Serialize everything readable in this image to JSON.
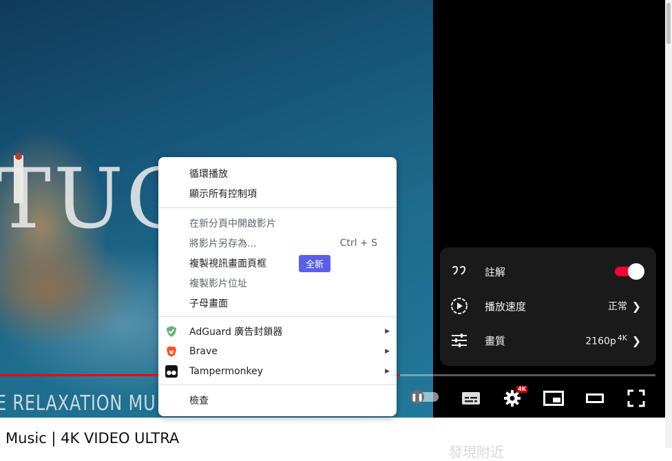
{
  "video": {
    "overlay_title_fragment": "TUGA",
    "overlay_subtitle_fragment": "E RELAXATION MU",
    "progress_fraction": 0.61
  },
  "controls": {
    "quality_badge": "4K",
    "icons": [
      "autoplay-pause-icon",
      "subtitles-icon",
      "settings-gear-icon",
      "miniplayer-icon",
      "theater-mode-icon",
      "fullscreen-icon"
    ]
  },
  "settings_panel": {
    "rows": [
      {
        "icon": "annotations-icon",
        "label": "註解",
        "toggle_on": true
      },
      {
        "icon": "playback-speed-icon",
        "label": "播放速度",
        "value": "正常"
      },
      {
        "icon": "quality-sliders-icon",
        "label": "畫質",
        "value": "2160p",
        "value_sup": "4K"
      }
    ]
  },
  "context_menu": {
    "loop": "循環播放",
    "show_controls": "顯示所有控制項",
    "open_new_tab": "在新分頁中開啟影片",
    "save_as": "將影片另存為...",
    "save_as_shortcut": "Ctrl + S",
    "copy_frame": "複製視訊畫面頁框",
    "new_badge": "全新",
    "copy_address": "複製影片位址",
    "pip": "子母畫面",
    "adguard": "AdGuard 廣告封鎖器",
    "brave": "Brave",
    "tampermonkey": "Tampermonkey",
    "inspect": "檢查"
  },
  "page": {
    "video_title": "Music | 4K VIDEO ULTRA",
    "faded_text": "發現附近"
  },
  "colors": {
    "accent_red": "#ff0033",
    "new_badge": "#5b5fe8",
    "adguard_green": "#67b279",
    "brave_orange": "#fb542b"
  }
}
